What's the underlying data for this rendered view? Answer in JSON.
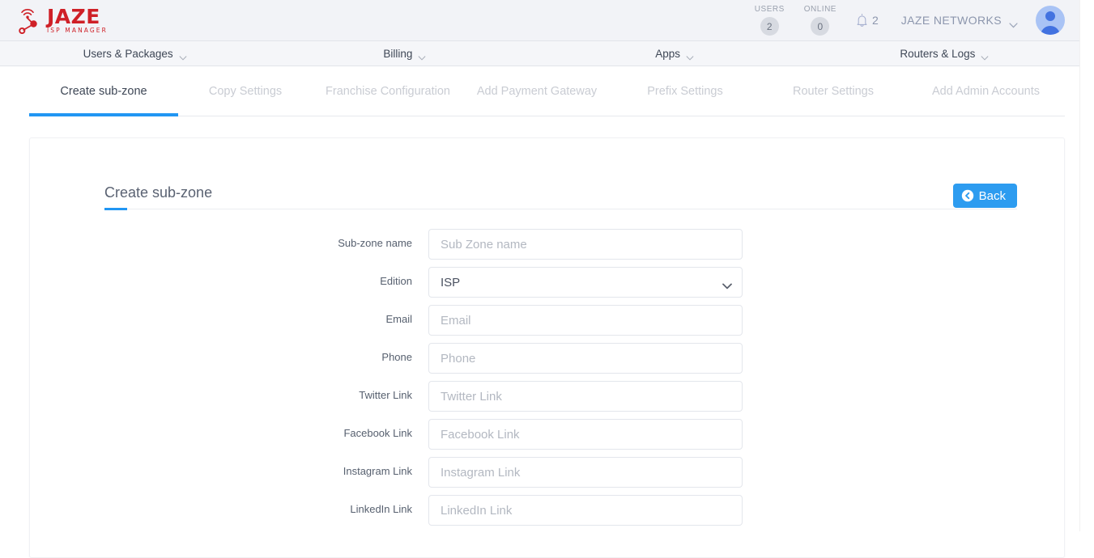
{
  "brand": {
    "name": "JAZE",
    "tagline": "ISP MANAGER",
    "color": "#cf2027",
    "logo_icon": "wifi-network-nodes-icon"
  },
  "header": {
    "stats": [
      {
        "label": "USERS",
        "value": "2"
      },
      {
        "label": "ONLINE",
        "value": "0"
      }
    ],
    "notifications": {
      "icon": "bell-icon",
      "count": "2"
    },
    "organization": "JAZE NETWORKS",
    "org_chevron_icon": "chevron-down-icon",
    "avatar_icon": "user-avatar-icon"
  },
  "mainnav": {
    "items": [
      {
        "label": "Users & Packages",
        "chevron_icon": "chevron-down-icon"
      },
      {
        "label": "Billing",
        "chevron_icon": "chevron-down-icon"
      },
      {
        "label": "Apps",
        "chevron_icon": "chevron-down-icon"
      },
      {
        "label": "Routers & Logs",
        "chevron_icon": "chevron-down-icon"
      }
    ]
  },
  "tabs": {
    "active_index": 0,
    "active_color": "#2196f3",
    "items": [
      {
        "label": "Create sub-zone"
      },
      {
        "label": "Copy Settings"
      },
      {
        "label": "Franchise Configuration"
      },
      {
        "label": "Add Payment Gateway"
      },
      {
        "label": "Prefix Settings"
      },
      {
        "label": "Router Settings"
      },
      {
        "label": "Add Admin Accounts"
      }
    ]
  },
  "card": {
    "title": "Create sub-zone",
    "accent_color": "#2196f3",
    "back_button": {
      "label": "Back",
      "icon": "arrow-circle-left-icon",
      "color": "#2d9cf0"
    }
  },
  "form": {
    "fields": [
      {
        "label": "Sub-zone name",
        "type": "text",
        "placeholder": "Sub Zone name",
        "value": ""
      },
      {
        "label": "Edition",
        "type": "select",
        "value": "ISP",
        "options": [
          "ISP"
        ],
        "chevron_icon": "chevron-down-icon"
      },
      {
        "label": "Email",
        "type": "text",
        "placeholder": "Email",
        "value": ""
      },
      {
        "label": "Phone",
        "type": "text",
        "placeholder": "Phone",
        "value": ""
      },
      {
        "label": "Twitter Link",
        "type": "text",
        "placeholder": "Twitter Link",
        "value": ""
      },
      {
        "label": "Facebook Link",
        "type": "text",
        "placeholder": "Facebook Link",
        "value": ""
      },
      {
        "label": "Instagram Link",
        "type": "text",
        "placeholder": "Instagram Link",
        "value": ""
      },
      {
        "label": "LinkedIn Link",
        "type": "text",
        "placeholder": "LinkedIn Link",
        "value": ""
      }
    ]
  }
}
